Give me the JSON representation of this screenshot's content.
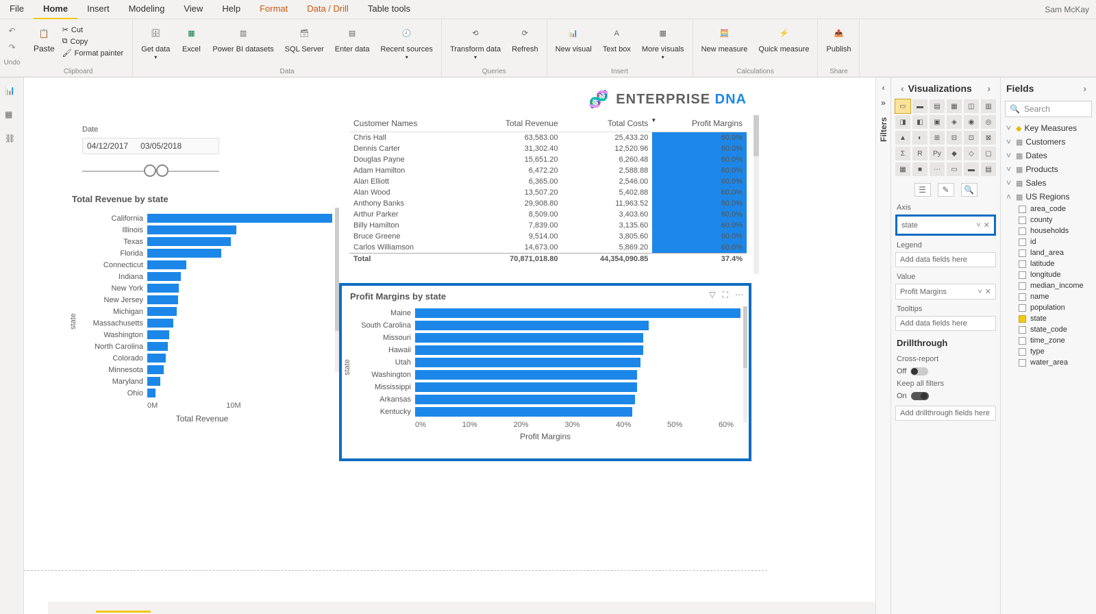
{
  "user": "Sam McKay",
  "menus": [
    "File",
    "Home",
    "Insert",
    "Modeling",
    "View",
    "Help",
    "Format",
    "Data / Drill",
    "Table tools"
  ],
  "ribbon": {
    "clipboard": {
      "paste": "Paste",
      "cut": "Cut",
      "copy": "Copy",
      "painter": "Format painter",
      "label": "Clipboard"
    },
    "data": {
      "get": "Get data",
      "excel": "Excel",
      "pbi": "Power BI datasets",
      "sql": "SQL Server",
      "enter": "Enter data",
      "recent": "Recent sources",
      "label": "Data"
    },
    "queries": {
      "transform": "Transform data",
      "refresh": "Refresh",
      "label": "Queries"
    },
    "insert": {
      "visual": "New visual",
      "text": "Text box",
      "more": "More visuals",
      "label": "Insert"
    },
    "calc": {
      "measure": "New measure",
      "quick": "Quick measure",
      "label": "Calculations"
    },
    "share": {
      "publish": "Publish",
      "label": "Share"
    },
    "undo": "Undo"
  },
  "brand": {
    "enterprise": "ENTERPRISE ",
    "dna": "DNA"
  },
  "slicer": {
    "title": "Date",
    "from": "04/12/2017",
    "to": "03/05/2018"
  },
  "table": {
    "headers": [
      "Customer Names",
      "Total Revenue",
      "Total Costs",
      "Profit Margins"
    ],
    "rows": [
      [
        "Chris Hall",
        "63,583.00",
        "25,433.20",
        "60.0%"
      ],
      [
        "Dennis Carter",
        "31,302.40",
        "12,520.96",
        "60.0%"
      ],
      [
        "Douglas Payne",
        "15,651.20",
        "6,260.48",
        "60.0%"
      ],
      [
        "Adam Hamilton",
        "6,472.20",
        "2,588.88",
        "60.0%"
      ],
      [
        "Alan Elliott",
        "6,365.00",
        "2,546.00",
        "60.0%"
      ],
      [
        "Alan Wood",
        "13,507.20",
        "5,402.88",
        "60.0%"
      ],
      [
        "Anthony Banks",
        "29,908.80",
        "11,963.52",
        "60.0%"
      ],
      [
        "Arthur Parker",
        "8,509.00",
        "3,403.60",
        "60.0%"
      ],
      [
        "Billy Hamilton",
        "7,839.00",
        "3,135.60",
        "60.0%"
      ],
      [
        "Bruce Greene",
        "9,514.00",
        "3,805.60",
        "60.0%"
      ],
      [
        "Carlos Williamson",
        "14,673.00",
        "5,869.20",
        "60.0%"
      ]
    ],
    "total": [
      "Total",
      "70,871,018.80",
      "44,354,090.85",
      "37.4%"
    ]
  },
  "chart_data": [
    {
      "type": "bar",
      "title": "Total Revenue by state",
      "ylabel": "state",
      "xlabel": "Total Revenue",
      "categories": [
        "California",
        "Illinois",
        "Texas",
        "Florida",
        "Connecticut",
        "Indiana",
        "New York",
        "New Jersey",
        "Michigan",
        "Massachusetts",
        "Washington",
        "North Carolina",
        "Colorado",
        "Minnesota",
        "Maryland",
        "Ohio"
      ],
      "values": [
        10000000,
        4800000,
        4500000,
        4000000,
        2100000,
        1800000,
        1700000,
        1650000,
        1600000,
        1400000,
        1200000,
        1100000,
        1000000,
        900000,
        700000,
        450000
      ],
      "xticks": [
        "0M",
        "10M"
      ],
      "xmax": 10000000
    },
    {
      "type": "bar",
      "title": "Profit Margins by state",
      "ylabel": "state",
      "xlabel": "Profit Margins",
      "categories": [
        "Maine",
        "South Carolina",
        "Missouri",
        "Hawaii",
        "Utah",
        "Washington",
        "Mississippi",
        "Arkansas",
        "Kentucky"
      ],
      "values": [
        60,
        43,
        42,
        42,
        41.5,
        41,
        41,
        40.5,
        40
      ],
      "xticks": [
        "0%",
        "10%",
        "20%",
        "30%",
        "40%",
        "50%",
        "60%"
      ],
      "xmax": 60
    }
  ],
  "viz": {
    "title": "Visualizations",
    "axis": "Axis",
    "axis_field": "state",
    "legend": "Legend",
    "legend_ph": "Add data fields here",
    "value": "Value",
    "value_field": "Profit Margins",
    "tooltips": "Tooltips",
    "tooltips_ph": "Add data fields here",
    "drill": "Drillthrough",
    "cross": "Cross-report",
    "off": "Off",
    "keep": "Keep all filters",
    "on": "On",
    "drill_ph": "Add drillthrough fields here"
  },
  "fields": {
    "title": "Fields",
    "search": "Search",
    "groups": [
      "Key Measures",
      "Customers",
      "Dates",
      "Products",
      "Sales",
      "US Regions"
    ],
    "us_fields": [
      "area_code",
      "county",
      "households",
      "id",
      "land_area",
      "latitude",
      "longitude",
      "median_income",
      "name",
      "population",
      "state",
      "state_code",
      "time_zone",
      "type",
      "water_area"
    ]
  },
  "filters_label": "Filters"
}
